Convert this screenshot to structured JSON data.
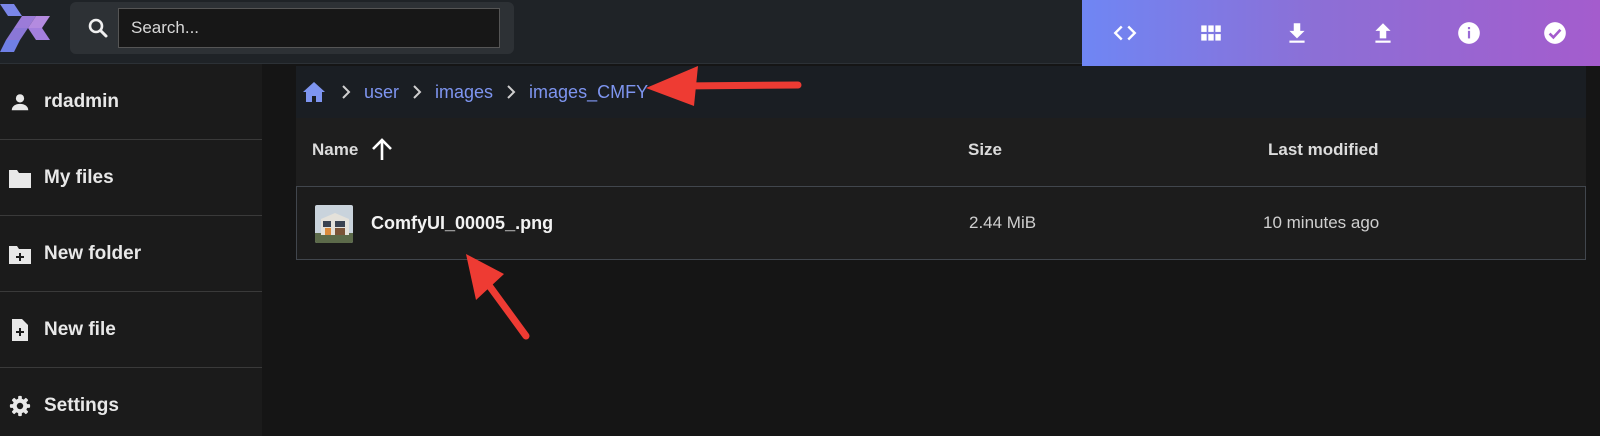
{
  "search": {
    "placeholder": "Search..."
  },
  "toolbar": {
    "actions": [
      {
        "icon": "code-icon"
      },
      {
        "icon": "grid-view-icon"
      },
      {
        "icon": "download-icon"
      },
      {
        "icon": "upload-icon"
      },
      {
        "icon": "info-icon"
      },
      {
        "icon": "check-circle-icon"
      }
    ]
  },
  "sidebar": {
    "items": [
      {
        "label": "rdadmin",
        "icon": "person-icon"
      },
      {
        "label": "My files",
        "icon": "folder-icon"
      },
      {
        "label": "New folder",
        "icon": "new-folder-icon"
      },
      {
        "label": "New file",
        "icon": "new-file-icon"
      },
      {
        "label": "Settings",
        "icon": "gear-icon"
      }
    ]
  },
  "breadcrumb": {
    "items": [
      "user",
      "images",
      "images_CMFY"
    ]
  },
  "table": {
    "headers": {
      "name": "Name",
      "size": "Size",
      "modified": "Last modified"
    },
    "rows": [
      {
        "name": "ComfyUI_00005_.png",
        "size": "2.44 MiB",
        "modified": "10 minutes ago"
      }
    ]
  },
  "colors": {
    "accent": "#7e95f0",
    "annotation": "#ee3b33"
  }
}
